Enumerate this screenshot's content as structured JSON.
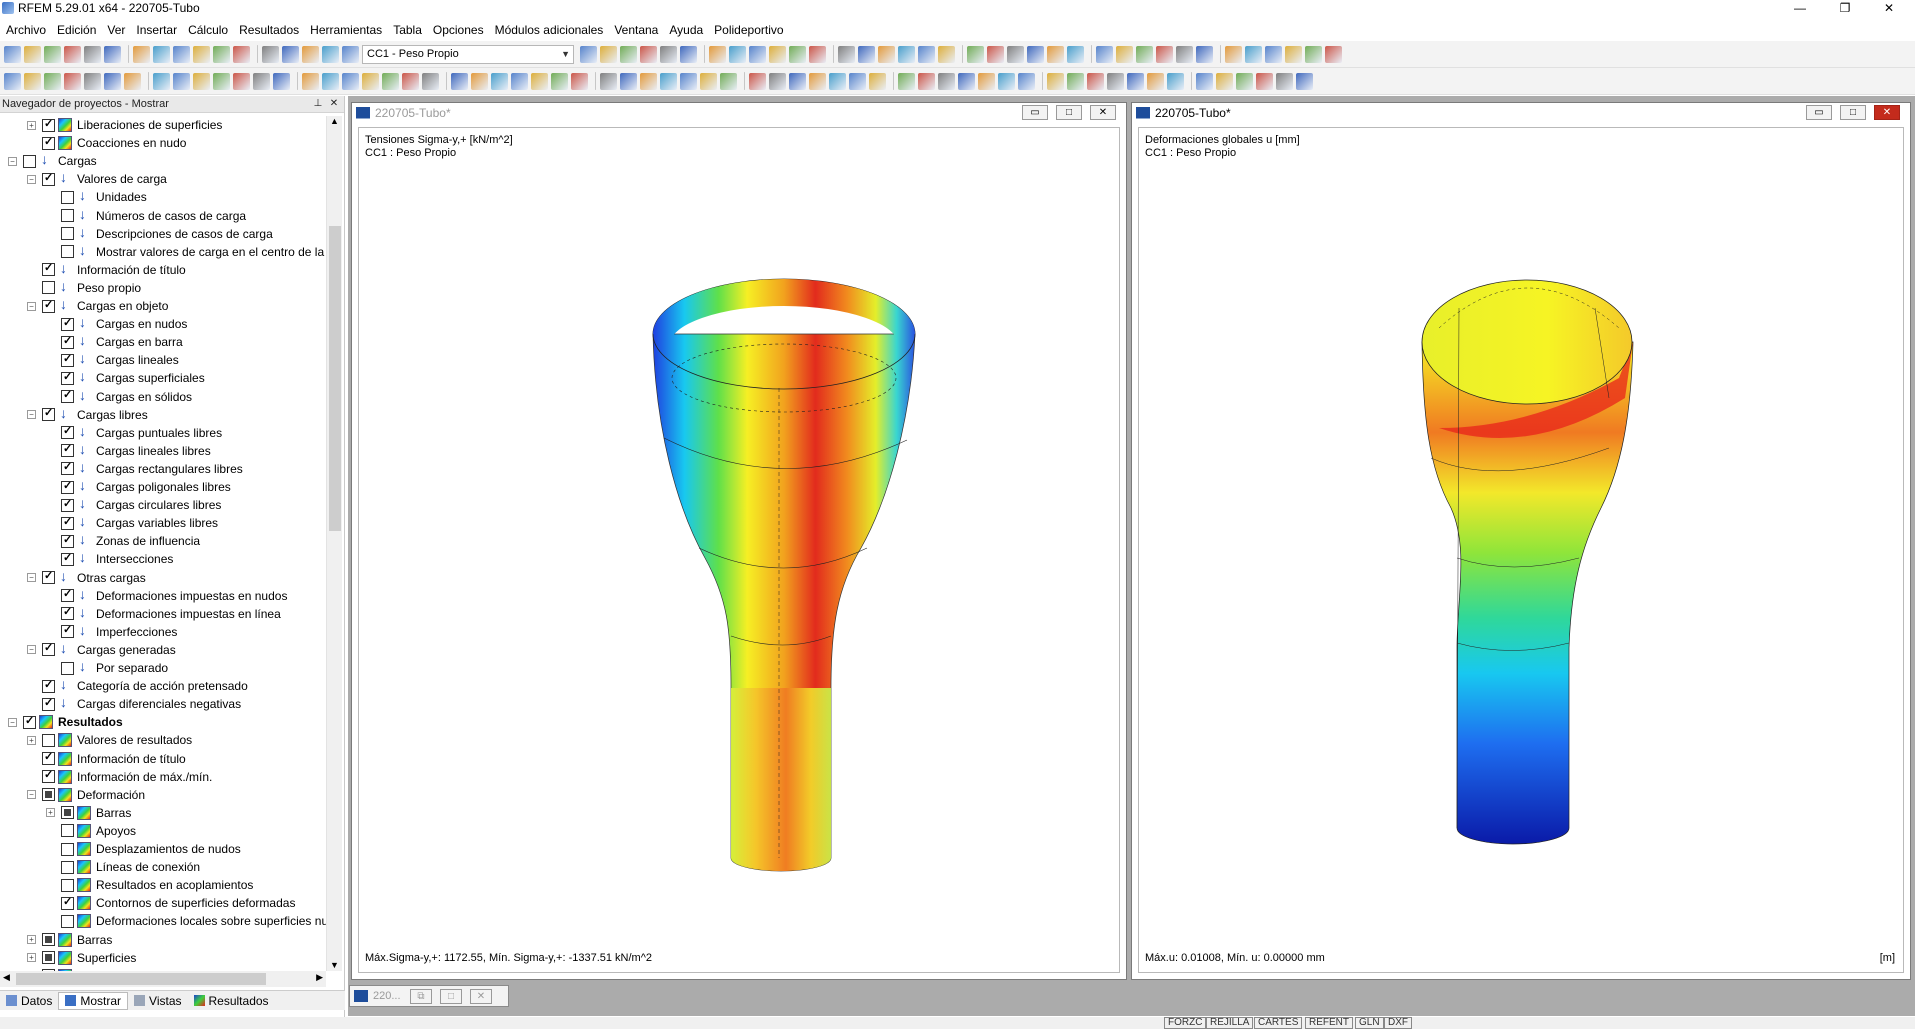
{
  "app": {
    "title": "RFEM 5.29.01 x64 - 220705-Tubo"
  },
  "menu": [
    "Archivo",
    "Edición",
    "Ver",
    "Insertar",
    "Cálculo",
    "Resultados",
    "Herramientas",
    "Tabla",
    "Opciones",
    "Módulos adicionales",
    "Ventana",
    "Ayuda",
    "Polideportivo"
  ],
  "toolbar": {
    "load_case": "CC1 - Peso Propio"
  },
  "navigator": {
    "title": "Navegador de proyectos - Mostrar",
    "items": [
      {
        "label": "Liberaciones de superficies",
        "level": 1,
        "check": "on",
        "icon": "res",
        "expander": "+"
      },
      {
        "label": "Coacciones en nudo",
        "level": 1,
        "check": "on",
        "icon": "res",
        "expander": ""
      },
      {
        "label": "Cargas",
        "level": 0,
        "check": "off",
        "icon": "load",
        "expander": "−"
      },
      {
        "label": "Valores de carga",
        "level": 1,
        "check": "on",
        "icon": "load",
        "expander": "−"
      },
      {
        "label": "Unidades",
        "level": 2,
        "check": "off",
        "icon": "load",
        "expander": ""
      },
      {
        "label": "Números de casos de carga",
        "level": 2,
        "check": "off",
        "icon": "load",
        "expander": ""
      },
      {
        "label": "Descripciones de casos de carga",
        "level": 2,
        "check": "off",
        "icon": "load",
        "expander": ""
      },
      {
        "label": "Mostrar valores de carga en el centro de la s",
        "level": 2,
        "check": "off",
        "icon": "load",
        "expander": ""
      },
      {
        "label": "Información de título",
        "level": 1,
        "check": "on",
        "icon": "load",
        "expander": ""
      },
      {
        "label": "Peso propio",
        "level": 1,
        "check": "off",
        "icon": "load",
        "expander": ""
      },
      {
        "label": "Cargas en objeto",
        "level": 1,
        "check": "on",
        "icon": "load",
        "expander": "−"
      },
      {
        "label": "Cargas en nudos",
        "level": 2,
        "check": "on",
        "icon": "load",
        "expander": ""
      },
      {
        "label": "Cargas en barra",
        "level": 2,
        "check": "on",
        "icon": "load",
        "expander": ""
      },
      {
        "label": "Cargas lineales",
        "level": 2,
        "check": "on",
        "icon": "load",
        "expander": ""
      },
      {
        "label": "Cargas superficiales",
        "level": 2,
        "check": "on",
        "icon": "load",
        "expander": ""
      },
      {
        "label": "Cargas en sólidos",
        "level": 2,
        "check": "on",
        "icon": "load",
        "expander": ""
      },
      {
        "label": "Cargas libres",
        "level": 1,
        "check": "on",
        "icon": "load",
        "expander": "−"
      },
      {
        "label": "Cargas puntuales libres",
        "level": 2,
        "check": "on",
        "icon": "load",
        "expander": ""
      },
      {
        "label": "Cargas lineales libres",
        "level": 2,
        "check": "on",
        "icon": "load",
        "expander": ""
      },
      {
        "label": "Cargas rectangulares libres",
        "level": 2,
        "check": "on",
        "icon": "load",
        "expander": ""
      },
      {
        "label": "Cargas poligonales libres",
        "level": 2,
        "check": "on",
        "icon": "load",
        "expander": ""
      },
      {
        "label": "Cargas circulares libres",
        "level": 2,
        "check": "on",
        "icon": "load",
        "expander": ""
      },
      {
        "label": "Cargas variables libres",
        "level": 2,
        "check": "on",
        "icon": "load",
        "expander": ""
      },
      {
        "label": "Zonas de influencia",
        "level": 2,
        "check": "on",
        "icon": "load",
        "expander": ""
      },
      {
        "label": "Intersecciones",
        "level": 2,
        "check": "on",
        "icon": "load",
        "expander": ""
      },
      {
        "label": "Otras cargas",
        "level": 1,
        "check": "on",
        "icon": "load",
        "expander": "−"
      },
      {
        "label": "Deformaciones impuestas en nudos",
        "level": 2,
        "check": "on",
        "icon": "load",
        "expander": ""
      },
      {
        "label": "Deformaciones impuestas en línea",
        "level": 2,
        "check": "on",
        "icon": "load",
        "expander": ""
      },
      {
        "label": "Imperfecciones",
        "level": 2,
        "check": "on",
        "icon": "load",
        "expander": ""
      },
      {
        "label": "Cargas generadas",
        "level": 1,
        "check": "on",
        "icon": "load",
        "expander": "−"
      },
      {
        "label": "Por separado",
        "level": 2,
        "check": "off",
        "icon": "load",
        "expander": ""
      },
      {
        "label": "Categoría de acción pretensado",
        "level": 1,
        "check": "on",
        "icon": "load",
        "expander": ""
      },
      {
        "label": "Cargas diferenciales negativas",
        "level": 1,
        "check": "on",
        "icon": "load",
        "expander": ""
      },
      {
        "label": "Resultados",
        "level": 0,
        "check": "on",
        "icon": "res",
        "expander": "−",
        "bold": true
      },
      {
        "label": "Valores de resultados",
        "level": 1,
        "check": "off",
        "icon": "res",
        "expander": "+"
      },
      {
        "label": "Información de título",
        "level": 1,
        "check": "on",
        "icon": "res",
        "expander": ""
      },
      {
        "label": "Información de máx./mín.",
        "level": 1,
        "check": "on",
        "icon": "res",
        "expander": ""
      },
      {
        "label": "Deformación",
        "level": 1,
        "check": "part",
        "icon": "res",
        "expander": "−"
      },
      {
        "label": "Barras",
        "level": 2,
        "check": "part",
        "icon": "res",
        "expander": "+"
      },
      {
        "label": "Apoyos",
        "level": 2,
        "check": "off",
        "icon": "res",
        "expander": ""
      },
      {
        "label": "Desplazamientos de nudos",
        "level": 2,
        "check": "off",
        "icon": "res",
        "expander": ""
      },
      {
        "label": "Líneas de conexión",
        "level": 2,
        "check": "off",
        "icon": "res",
        "expander": ""
      },
      {
        "label": "Resultados en acoplamientos",
        "level": 2,
        "check": "off",
        "icon": "res",
        "expander": ""
      },
      {
        "label": "Contornos de superficies deformadas",
        "level": 2,
        "check": "on",
        "icon": "res",
        "expander": ""
      },
      {
        "label": "Deformaciones locales sobre superficies nu",
        "level": 2,
        "check": "off",
        "icon": "res",
        "expander": ""
      },
      {
        "label": "Barras",
        "level": 1,
        "check": "part",
        "icon": "res",
        "expander": "+"
      },
      {
        "label": "Superficies",
        "level": 1,
        "check": "part",
        "icon": "res",
        "expander": "+"
      },
      {
        "label": "Sólidos",
        "level": 1,
        "check": "part",
        "icon": "res",
        "expander": "+"
      }
    ],
    "tabs": [
      "Datos",
      "Mostrar",
      "Vistas",
      "Resultados"
    ]
  },
  "windows": {
    "left": {
      "title": "220705-Tubo*",
      "line1": "Tensiones Sigma-y,+ [kN/m^2]",
      "line2": "CC1 : Peso Propio",
      "footer": "Máx.Sigma-y,+: 1172.55, Mín. Sigma-y,+: -1337.51 kN/m^2"
    },
    "right": {
      "title": "220705-Tubo*",
      "line1": "Deformaciones globales u [mm]",
      "line2": "CC1 : Peso Propio",
      "footer": "Máx.u: 0.01008, Mín. u: 0.00000 mm",
      "unit": "[m]"
    },
    "minimized": {
      "title": "220..."
    }
  },
  "statusbar": [
    "FORZC",
    "REJILLA",
    "CARTES",
    "REFENT",
    "GLN",
    "DXF"
  ]
}
